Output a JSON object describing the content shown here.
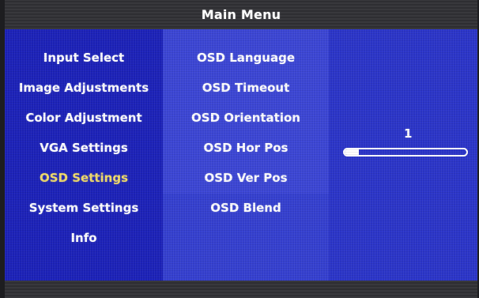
{
  "header": {
    "title": "Main Menu"
  },
  "main_menu": {
    "items": [
      {
        "label": "Input Select",
        "selected": false
      },
      {
        "label": "Image Adjustments",
        "selected": false
      },
      {
        "label": "Color Adjustment",
        "selected": false
      },
      {
        "label": "VGA Settings",
        "selected": false
      },
      {
        "label": "OSD Settings",
        "selected": true
      },
      {
        "label": "System Settings",
        "selected": false
      },
      {
        "label": "Info",
        "selected": false
      }
    ]
  },
  "submenu": {
    "items": [
      {
        "label": "OSD Language"
      },
      {
        "label": "OSD Timeout"
      },
      {
        "label": "OSD Orientation"
      },
      {
        "label": "OSD Hor Pos"
      },
      {
        "label": "OSD Ver Pos"
      },
      {
        "label": "OSD Blend"
      }
    ]
  },
  "value_panel": {
    "value_text": "1",
    "slider_level": 0.12
  },
  "colors": {
    "panel_blue": "#1f2ab4",
    "submenu_blue": "#3c46d4",
    "highlight_text": "#f2dc6a",
    "text": "#ffffff",
    "frame": "#2e2e32"
  }
}
